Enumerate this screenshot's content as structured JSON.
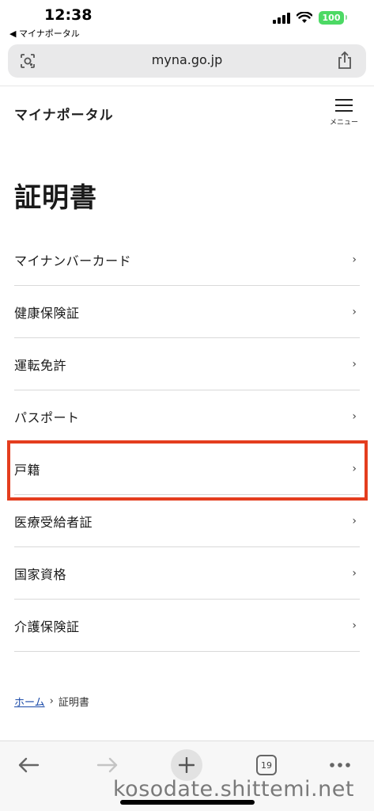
{
  "status_bar": {
    "time": "12:38",
    "back_app": "◀ マイナポータル",
    "battery": "100"
  },
  "browser": {
    "url": "myna.go.jp",
    "lens_icon": "visual-search-icon",
    "share_icon": "share-icon"
  },
  "site": {
    "logo": "マイナポータル",
    "menu_label": "メニュー"
  },
  "page": {
    "title": "証明書"
  },
  "list": {
    "items": [
      {
        "label": "マイナンバーカード"
      },
      {
        "label": "健康保険証"
      },
      {
        "label": "運転免許"
      },
      {
        "label": "パスポート"
      },
      {
        "label": "戸籍"
      },
      {
        "label": "医療受給者証"
      },
      {
        "label": "国家資格"
      },
      {
        "label": "介護保険証"
      }
    ],
    "chevron": "›"
  },
  "breadcrumb": {
    "home": "ホーム",
    "separator": "›",
    "current": "証明書"
  },
  "toolbar": {
    "tab_count": "19"
  },
  "watermark": "kosodate.shittemi.net",
  "colors": {
    "highlight": "#e43d1e",
    "battery": "#4cd964",
    "link": "#1a4aa8"
  }
}
